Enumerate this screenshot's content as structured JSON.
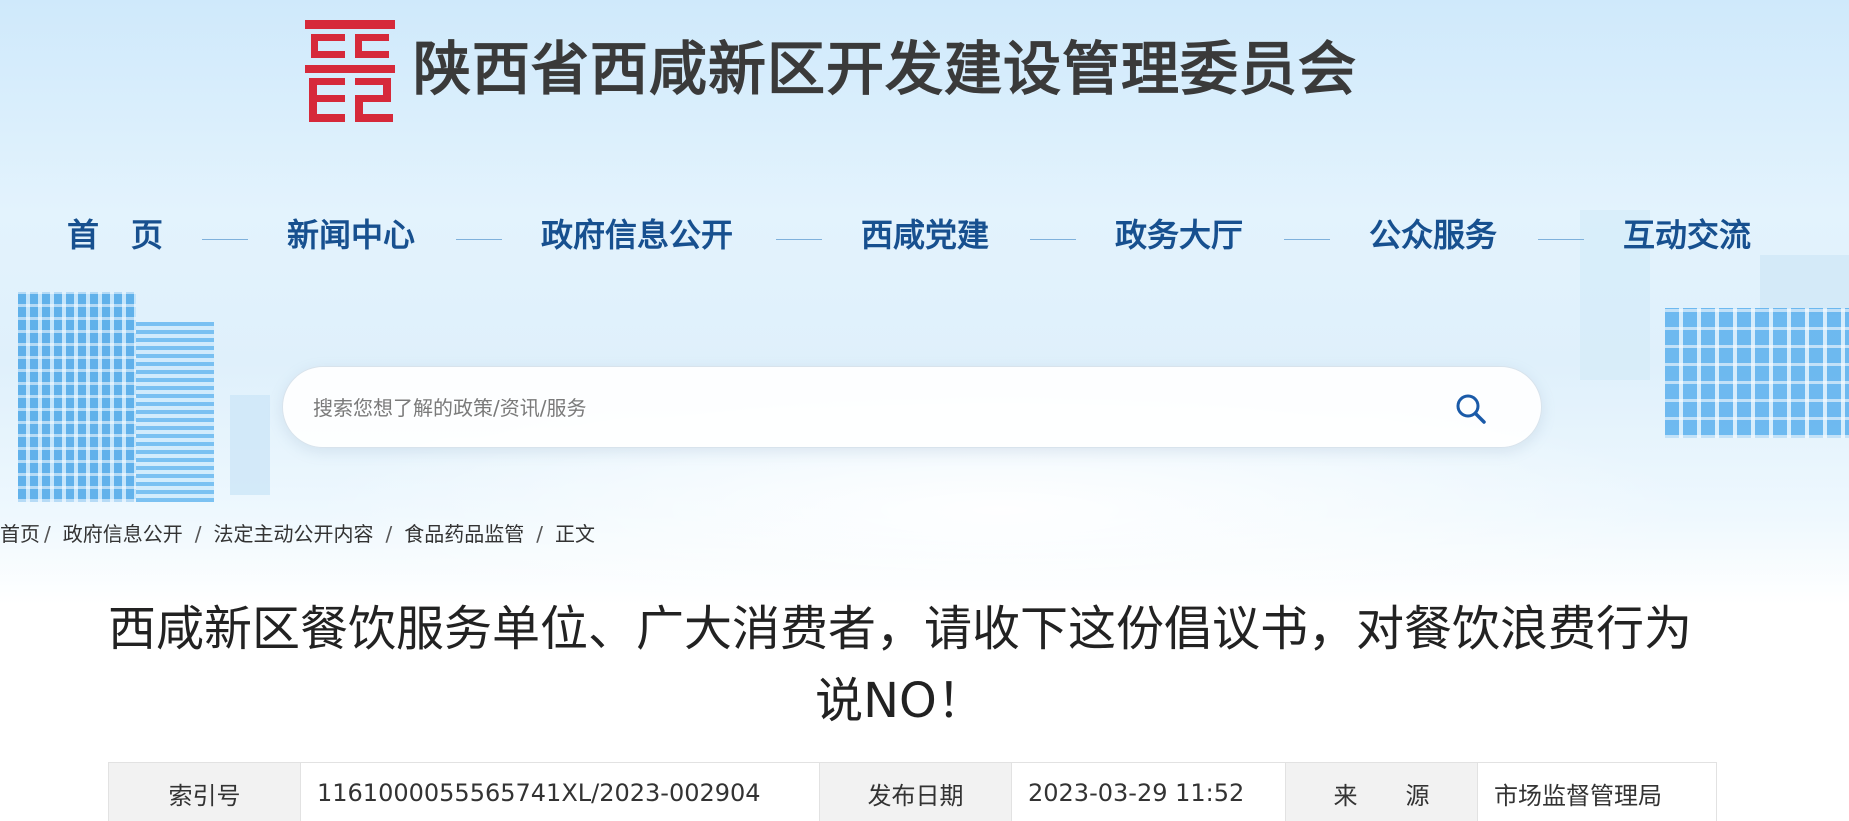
{
  "site": {
    "title": "陕西省西咸新区开发建设管理委员会",
    "logo_color": "#d6293a"
  },
  "nav": {
    "items": [
      "首　页",
      "新闻中心",
      "政府信息公开",
      "西咸党建",
      "政务大厅",
      "公众服务",
      "互动交流"
    ],
    "text_color": "#17508f"
  },
  "search": {
    "placeholder": "搜索您想了解的政策/资讯/服务",
    "icon": "search-icon"
  },
  "breadcrumb": {
    "items": [
      "首页",
      "政府信息公开",
      "法定主动公开内容",
      "食品药品监管",
      "正文"
    ],
    "separator": "/"
  },
  "article": {
    "title_line1": "西咸新区餐饮服务单位、广大消费者，请收下这份倡议书，对餐饮浪费行为",
    "title_line2": "说NO！"
  },
  "meta": {
    "index_label": "索引号",
    "index_value": "11610000555657 41XL/2023-002904",
    "date_label": "发布日期",
    "date_value": "2023-03-29 11:52",
    "source_label": "来　　源",
    "source_value": "市场监督管理局"
  }
}
